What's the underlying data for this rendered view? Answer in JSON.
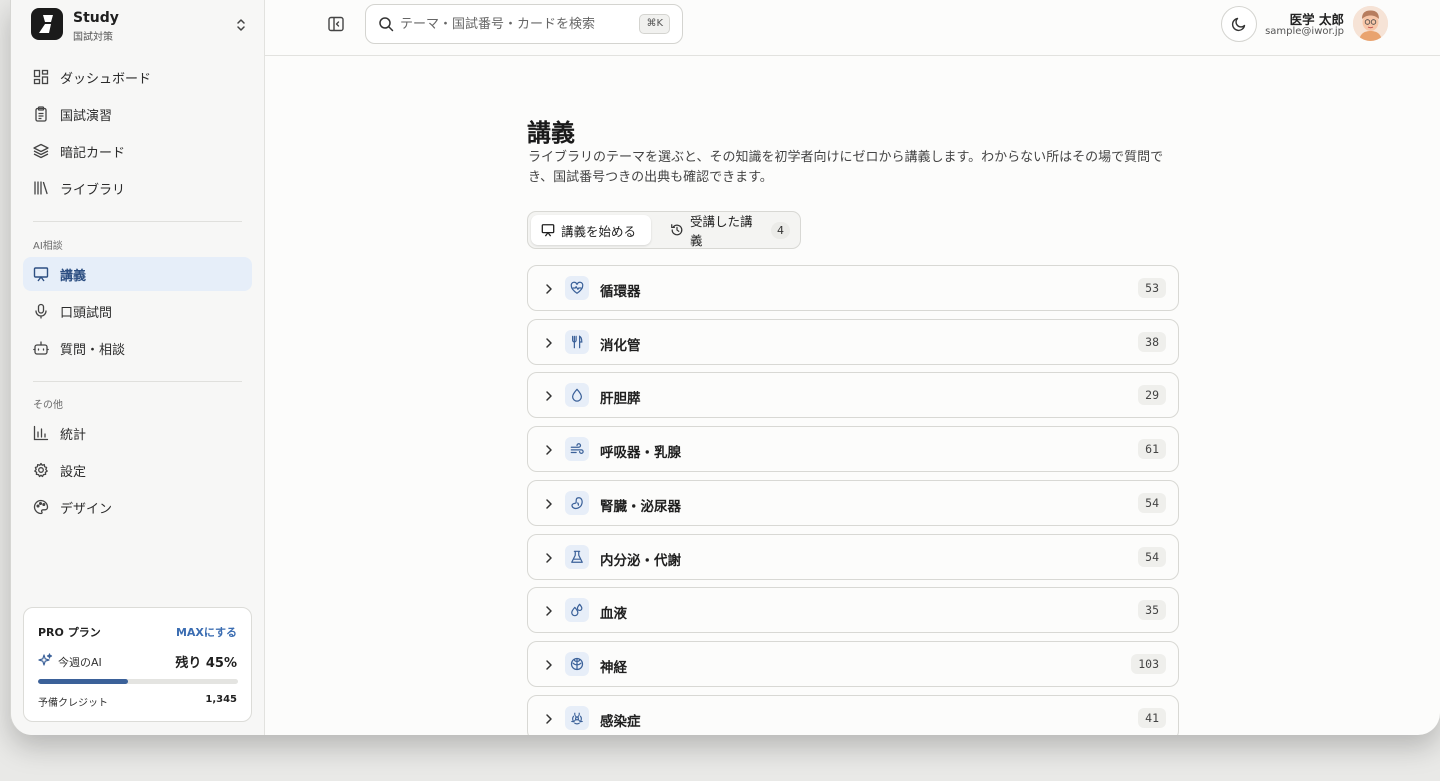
{
  "brand": {
    "title": "Study",
    "subtitle": "国試対策"
  },
  "nav": {
    "main": [
      {
        "label": "ダッシュボード",
        "icon": "dashboard-icon"
      },
      {
        "label": "国試演習",
        "icon": "clipboard-icon"
      },
      {
        "label": "暗記カード",
        "icon": "layers-icon"
      },
      {
        "label": "ライブラリ",
        "icon": "library-icon"
      }
    ],
    "ai_section": "AI相談",
    "ai": [
      {
        "label": "講義",
        "icon": "presentation-icon",
        "active": true
      },
      {
        "label": "口頭試問",
        "icon": "mic-icon"
      },
      {
        "label": "質問・相談",
        "icon": "bot-icon"
      }
    ],
    "other_section": "その他",
    "other": [
      {
        "label": "統計",
        "icon": "bar-chart-icon"
      },
      {
        "label": "設定",
        "icon": "gear-icon"
      },
      {
        "label": "デザイン",
        "icon": "palette-icon"
      }
    ]
  },
  "plan": {
    "name": "PRO プラン",
    "upgrade": "MAXにする",
    "ai_label": "今週のAI",
    "remaining": "残り 45%",
    "remaining_fraction": 0.45,
    "reserve_label": "予備クレジット",
    "reserve_value": "1,345"
  },
  "header": {
    "search_placeholder": "テーマ・国試番号・カードを検索",
    "shortcut": "⌘K",
    "user_name": "医学 太郎",
    "user_email": "sample@iwor.jp"
  },
  "page": {
    "title": "講義",
    "description": "ライブラリのテーマを選ぶと、その知識を初学者向けにゼロから講義します。わからない所はその場で質問でき、国試番号つきの出典も確認できます。",
    "tabs": {
      "start": "講義を始める",
      "history": "受講した講義",
      "history_count": "4"
    }
  },
  "topics": [
    {
      "name": "循環器",
      "count": "53",
      "icon": "heart-pulse-icon"
    },
    {
      "name": "消化管",
      "count": "38",
      "icon": "utensils-icon"
    },
    {
      "name": "肝胆膵",
      "count": "29",
      "icon": "droplet-icon"
    },
    {
      "name": "呼吸器・乳腺",
      "count": "61",
      "icon": "wind-icon"
    },
    {
      "name": "腎臓・泌尿器",
      "count": "54",
      "icon": "kidney-icon"
    },
    {
      "name": "内分泌・代謝",
      "count": "54",
      "icon": "flask-icon"
    },
    {
      "name": "血液",
      "count": "35",
      "icon": "droplets-icon"
    },
    {
      "name": "神経",
      "count": "103",
      "icon": "brain-icon"
    },
    {
      "name": "感染症",
      "count": "41",
      "icon": "biohazard-icon"
    }
  ],
  "colors": {
    "accent": "#3b6199",
    "active_bg": "#e6eef9",
    "icon_bg": "#e7eef8"
  }
}
